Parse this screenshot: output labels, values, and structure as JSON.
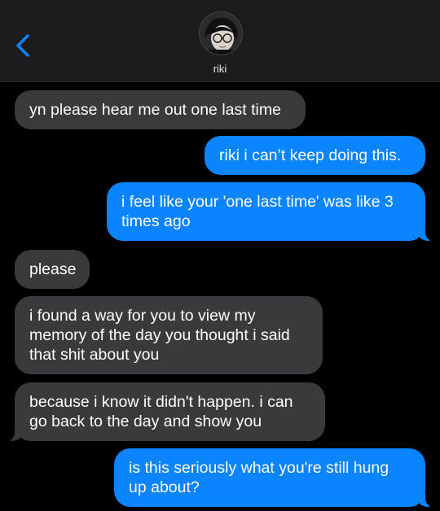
{
  "header": {
    "contact_name": "riki",
    "back_icon": "chevron-left-icon",
    "accent_color": "#0a84ff"
  },
  "messages": [
    {
      "from": "them",
      "text": "yn please hear me out one last time"
    },
    {
      "from": "me",
      "text": "riki i can’t keep doing this."
    },
    {
      "from": "me",
      "text": "i feel like your 'one last time' was like 3 times ago"
    },
    {
      "from": "them",
      "text": "please"
    },
    {
      "from": "them",
      "text": "i found a way for you to view my memory of the day you thought i said that shit about you"
    },
    {
      "from": "them",
      "text": "because i know it didn't happen. i can go back to the day and show you"
    },
    {
      "from": "me",
      "text": "is this seriously what you're still hung up about?"
    }
  ]
}
